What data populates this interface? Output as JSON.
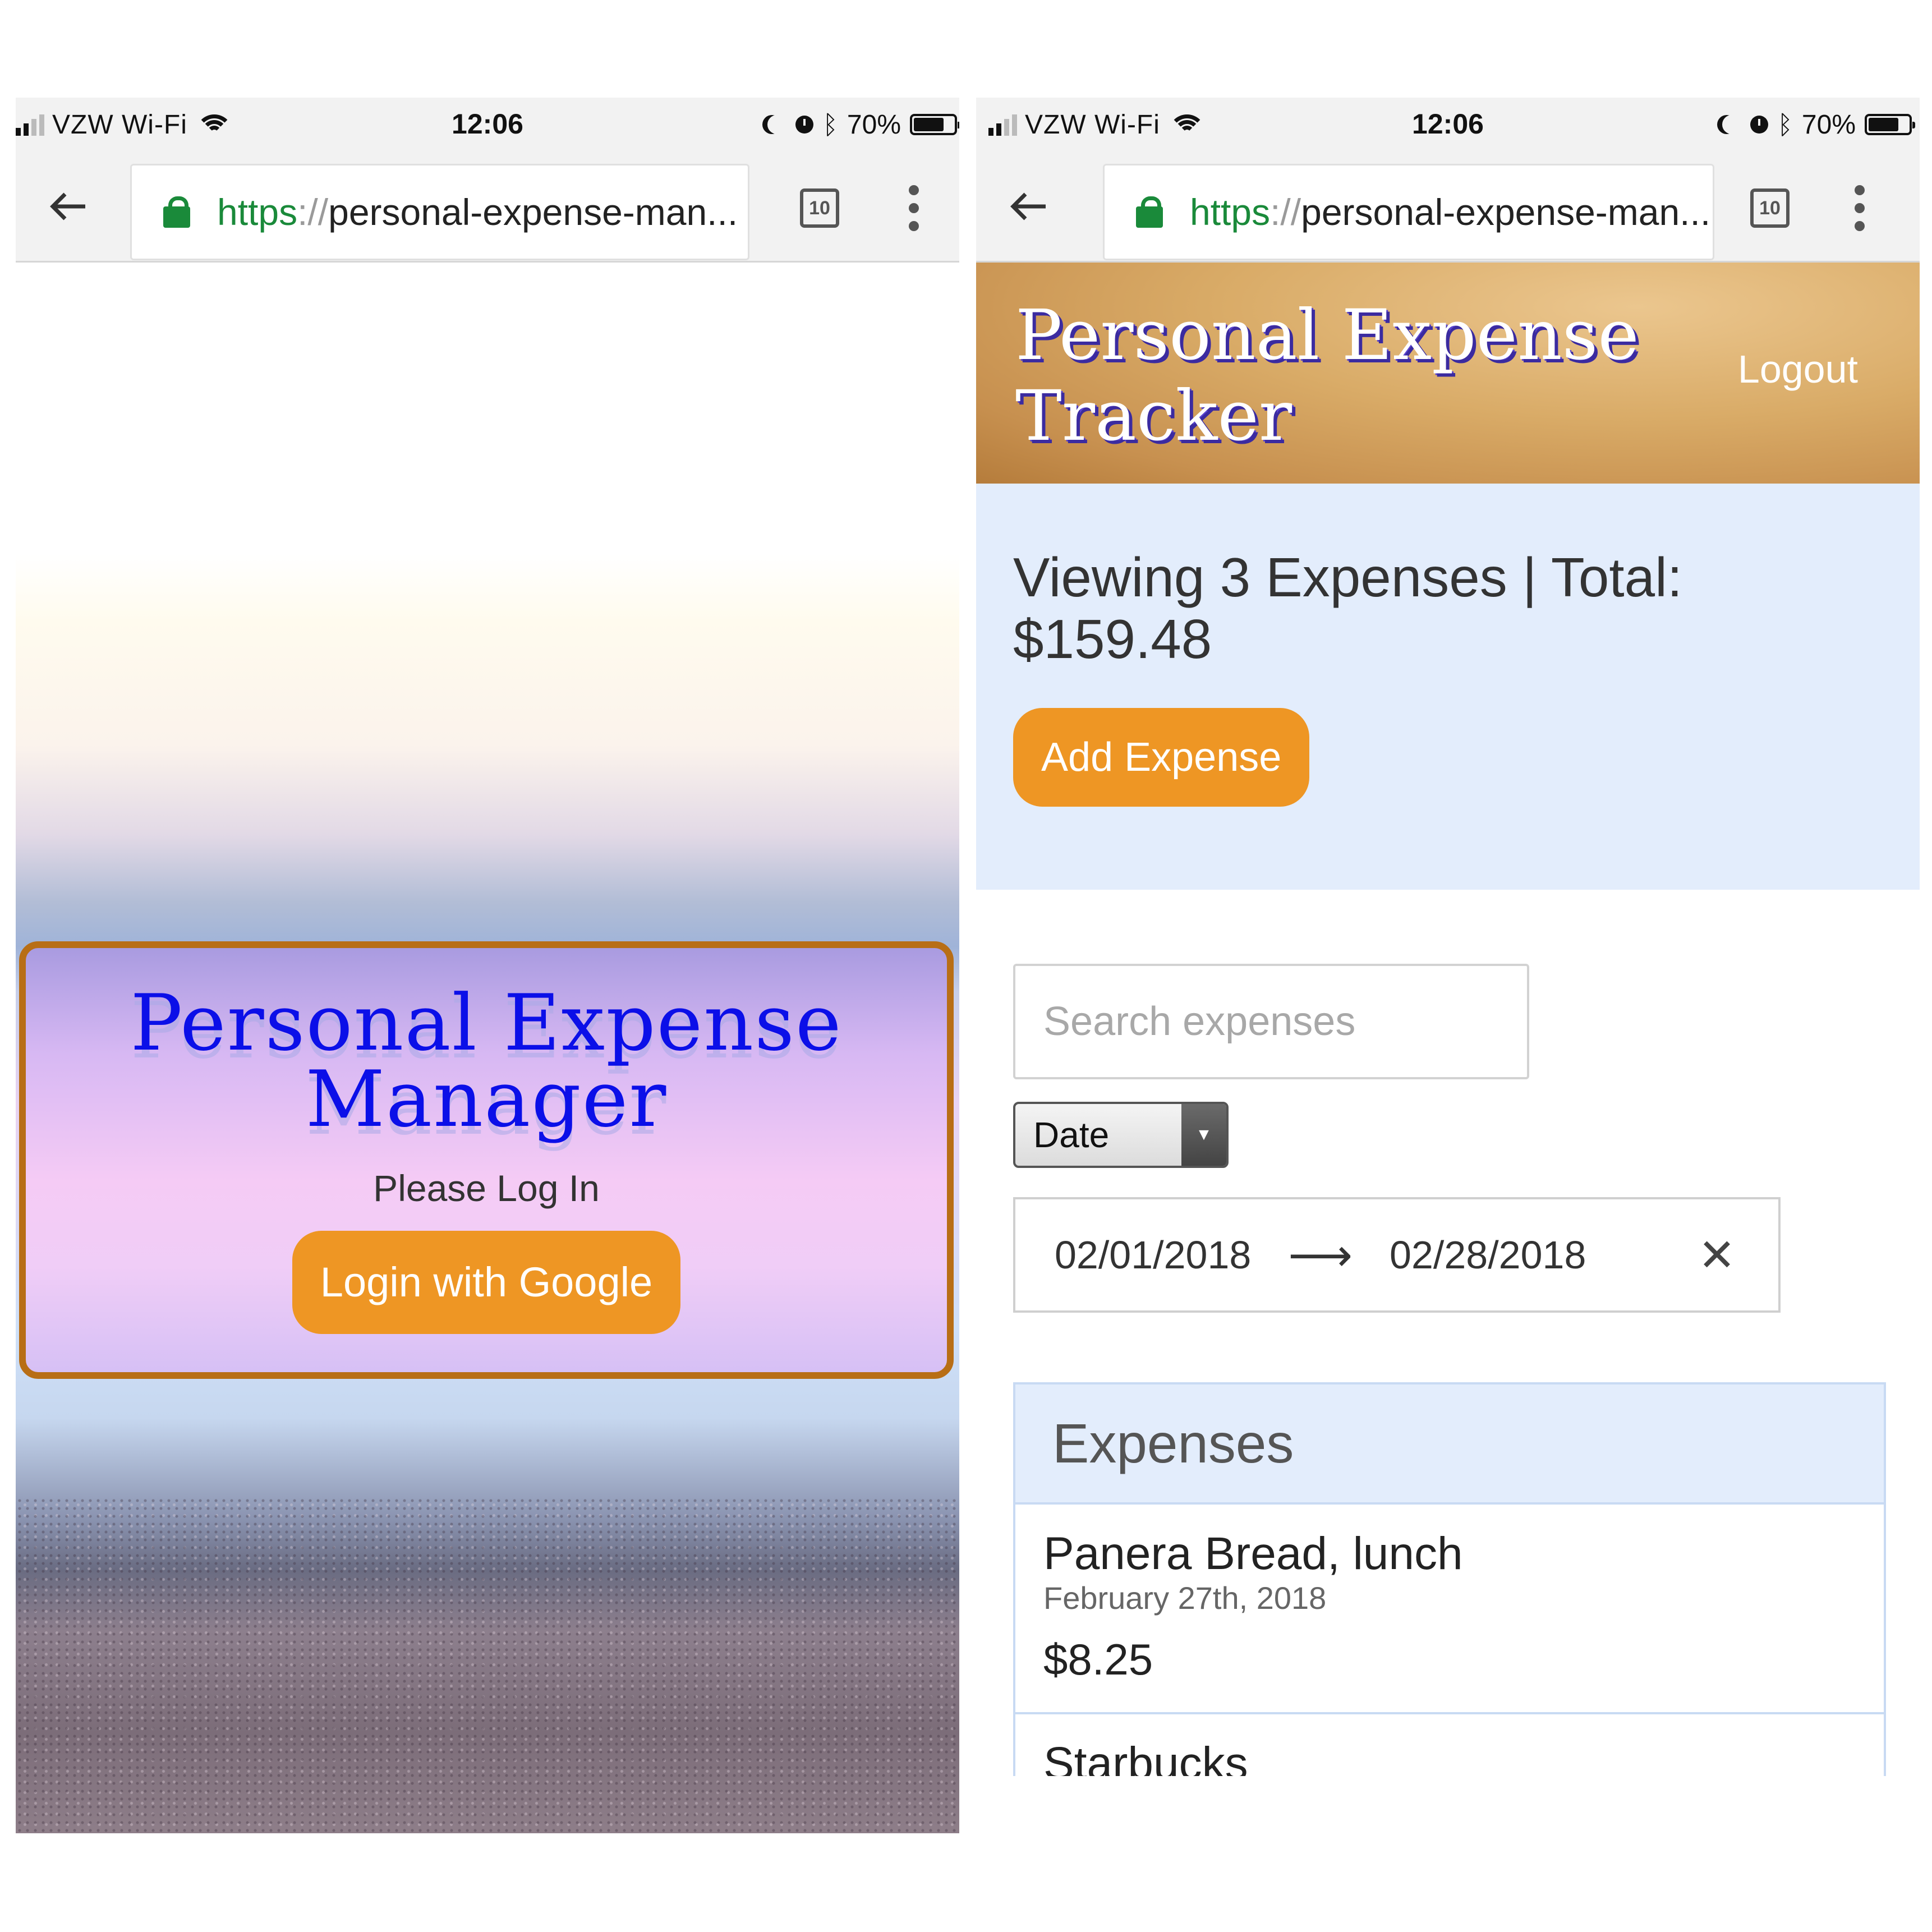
{
  "status_bar": {
    "carrier": "VZW Wi-Fi",
    "time": "12:06",
    "battery": "70%"
  },
  "browser": {
    "url_scheme": "https",
    "url_separator": "://",
    "url_rest": "personal-expense-man...",
    "tab_count": "10"
  },
  "login_screen": {
    "title": "Personal Expense Manager",
    "subtitle": "Please Log In",
    "login_button": "Login with Google"
  },
  "dashboard": {
    "header_title": "Personal Expense Tracker",
    "logout": "Logout",
    "summary": "Viewing 3 Expenses | Total: $159.48",
    "add_button": "Add Expense",
    "search_placeholder": "Search expenses",
    "sort_by": "Date",
    "date_start": "02/01/2018",
    "date_arrow": "⟶",
    "date_end": "02/28/2018",
    "date_clear": "✕",
    "list_title": "Expenses",
    "expenses": [
      {
        "description": "Panera Bread, lunch",
        "date": "February 27th, 2018",
        "amount": "$8.25"
      },
      {
        "description": "Starbucks"
      }
    ]
  },
  "colors": {
    "accent_orange": "#ee9624",
    "card_border": "#b86e16",
    "title_blue": "#0b0fe8",
    "panel_blue": "#e3edfc",
    "secure_green": "#1a8a3a"
  }
}
